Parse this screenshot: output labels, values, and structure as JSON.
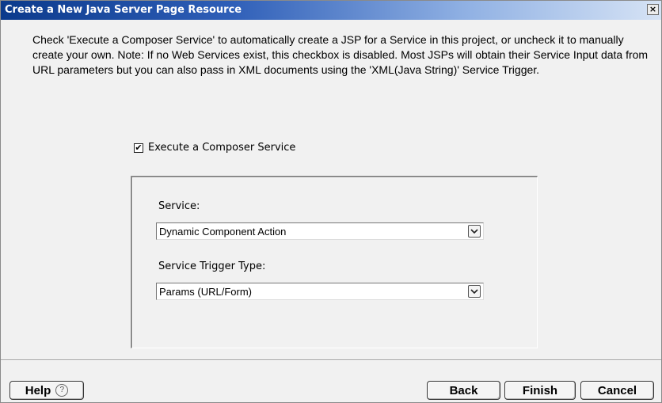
{
  "window": {
    "title": "Create a New Java Server Page Resource",
    "close_glyph": "×"
  },
  "instructions": "Check 'Execute a Composer Service' to automatically create a JSP for a Service in this project, or uncheck it to manually create your own.  Note: If  no Web Services exist, this checkbox is disabled.  Most JSPs will obtain their Service Input data from URL parameters but you can also pass in XML documents using the 'XML(Java String)' Service Trigger.",
  "execute_checkbox": {
    "label": "Execute a Composer Service",
    "checked": true,
    "check_glyph": "✔"
  },
  "service": {
    "label": "Service:",
    "value": "Dynamic Component Action"
  },
  "trigger": {
    "label": "Service Trigger Type:",
    "value": "Params (URL/Form)"
  },
  "buttons": {
    "help": "Help",
    "help_icon": "?",
    "back": "Back",
    "finish": "Finish",
    "cancel": "Cancel"
  },
  "colors": {
    "title_bar_start": "#0b3a8c",
    "title_bar_end": "#d6e3f5",
    "background": "#f1f1f1"
  }
}
